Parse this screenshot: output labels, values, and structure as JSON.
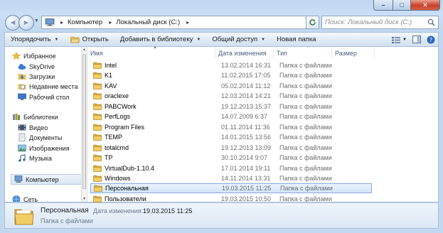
{
  "window": {
    "caption": {
      "minimize": "–",
      "maximize": "□",
      "close": "✕"
    }
  },
  "nav_buttons": {
    "back": "◄",
    "forward": "►",
    "history": "▼"
  },
  "address": {
    "crumbs": [
      "Компьютер",
      "Локальный диск (C:)"
    ],
    "separator": "▸"
  },
  "search": {
    "placeholder": "Поиск: Локальный диск (C:)"
  },
  "toolbar": {
    "organize": "Упорядочить",
    "open": "Открыть",
    "add_to_library": "Добавить в библиотеку",
    "share": "Общий доступ",
    "new_folder": "Новая папка",
    "dropdown_arrow": "▼"
  },
  "sidebar": {
    "groups": [
      {
        "label": "Избранное",
        "icon": "star-icon"
      },
      {
        "label": "SkyDrive",
        "icon": "skydrive-icon"
      },
      {
        "label": "Загрузки",
        "icon": "downloads-icon"
      },
      {
        "label": "Недавние места",
        "icon": "recent-places-icon"
      },
      {
        "label": "Рабочий стол",
        "icon": "desktop-icon"
      },
      {
        "label": "Библиотеки",
        "icon": "libraries-icon"
      },
      {
        "label": "Видео",
        "icon": "video-icon"
      },
      {
        "label": "Документы",
        "icon": "documents-icon"
      },
      {
        "label": "Изображения",
        "icon": "images-icon"
      },
      {
        "label": "Музыка",
        "icon": "music-icon"
      },
      {
        "label": "Компьютер",
        "icon": "computer-icon"
      },
      {
        "label": "Сеть",
        "icon": "network-icon"
      }
    ]
  },
  "columns": {
    "name": "Имя",
    "date": "Дата изменения",
    "type": "Тип",
    "size": "Размер"
  },
  "files": [
    {
      "name": "Intel",
      "date": "13.02.2014 16:31",
      "type": "Папка с файлами"
    },
    {
      "name": "K1",
      "date": "11.02.2015 17:05",
      "type": "Папка с файлами"
    },
    {
      "name": "KAV",
      "date": "05.02.2014 11:12",
      "type": "Папка с файлами"
    },
    {
      "name": "oraclexe",
      "date": "12.03.2014 14:21",
      "type": "Папка с файлами"
    },
    {
      "name": "PABCWork",
      "date": "19.12.2013 15:37",
      "type": "Папка с файлами"
    },
    {
      "name": "PerfLogs",
      "date": "14.07.2009 6:37",
      "type": "Папка с файлами"
    },
    {
      "name": "Program Files",
      "date": "01.11.2014 11:36",
      "type": "Папка с файлами"
    },
    {
      "name": "TEMP",
      "date": "14.01.2015 13:56",
      "type": "Папка с файлами"
    },
    {
      "name": "totalcmd",
      "date": "19.12.2013 13:09",
      "type": "Папка с файлами"
    },
    {
      "name": "TP",
      "date": "30.10.2014 9:07",
      "type": "Папка с файлами"
    },
    {
      "name": "VirtualDub-1.10.4",
      "date": "17.01.2014 19:11",
      "type": "Папка с файлами"
    },
    {
      "name": "Windows",
      "date": "14.11.2014 13:31",
      "type": "Папка с файлами"
    },
    {
      "name": "Персональная",
      "date": "19.03.2015 11:25",
      "type": "Папка с файлами"
    },
    {
      "name": "Пользователи",
      "date": "19.03.2015 10:50",
      "type": "Папка с файлами"
    }
  ],
  "selected_index": 12,
  "details": {
    "name": "Персональная",
    "date_label": "Дата изменения:",
    "date_value": "19.03.2015 11:25",
    "type": "Папка с файлами"
  },
  "colors": {
    "folder": "#e8c25a",
    "selection_border": "#84acdd",
    "frame": "#c6dbf2"
  }
}
